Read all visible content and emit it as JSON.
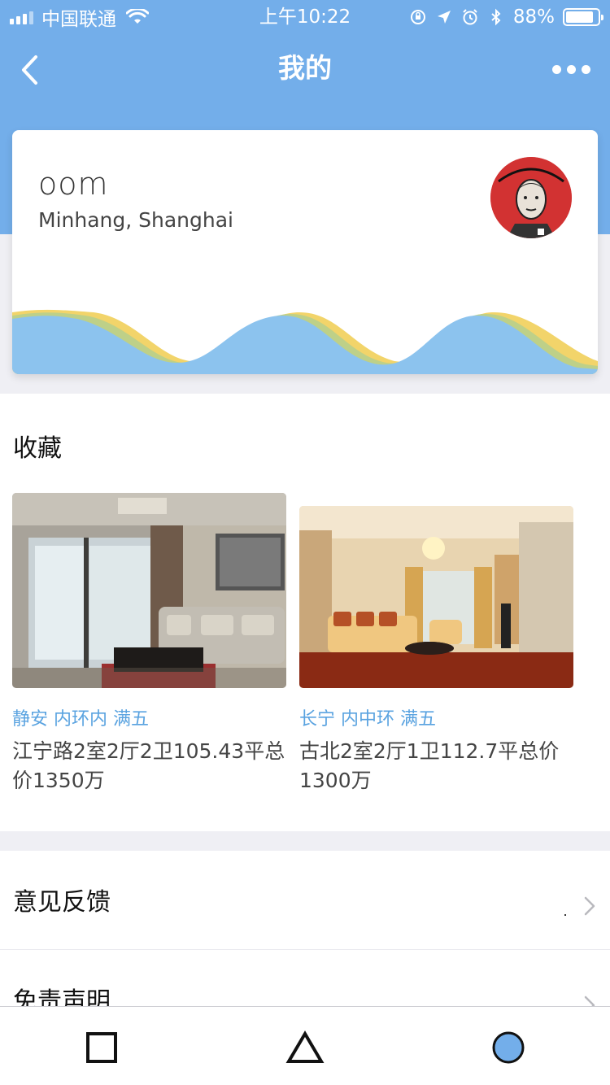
{
  "status_bar": {
    "carrier": "中国联通",
    "time": "上午10:22",
    "battery_percent": "88%",
    "battery_level": 0.88,
    "icons": [
      "signal-icon",
      "wifi-icon",
      "orientation-lock-icon",
      "location-icon",
      "alarm-icon",
      "bluetooth-icon",
      "battery-icon"
    ]
  },
  "navbar": {
    "title": "我的",
    "back_icon": "chevron-left-icon",
    "more_icon": "more-dots-icon"
  },
  "profile": {
    "username": "oom",
    "location": "Minhang, Shanghai",
    "avatar_icon": "avatar-image"
  },
  "favorites": {
    "title": "收藏",
    "items": [
      {
        "tags": "静安 内环内 满五",
        "description": "江宁路2室2厅2卫105.43平总价1350万",
        "photo": "apartment-photo-living-room"
      },
      {
        "tags": "长宁 内中环 满五",
        "description": "古北2室2厅1卫112.7平总价1300万",
        "photo": "apartment-photo-sofa-room"
      }
    ]
  },
  "menu": {
    "items": [
      {
        "label": "意见反馈"
      },
      {
        "label": "免责声明"
      }
    ]
  },
  "bottom_nav": {
    "items": [
      "square-icon",
      "triangle-icon",
      "circle-icon"
    ]
  },
  "colors": {
    "header": "#73aeea",
    "tag_text": "#5aa3e0",
    "wave_blue": "#8cc3ee",
    "wave_yellow": "#f2d46a",
    "bottom_circle_fill": "#73aeea"
  }
}
